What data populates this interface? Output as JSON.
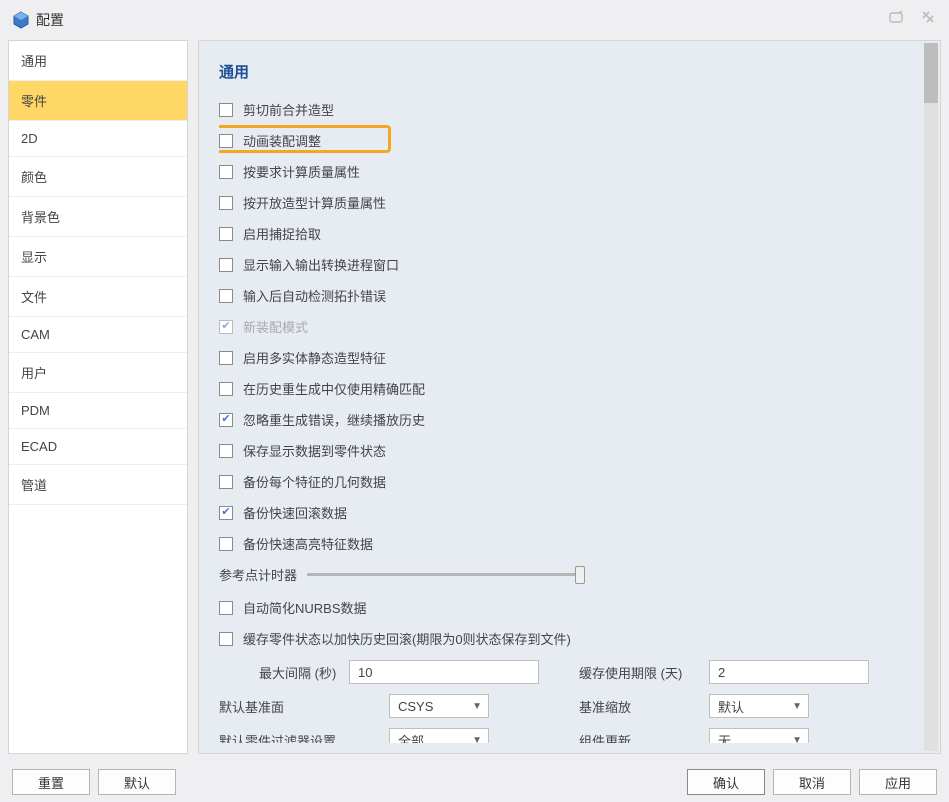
{
  "window": {
    "title": "配置"
  },
  "sidebar": {
    "items": [
      "通用",
      "零件",
      "2D",
      "颜色",
      "背景色",
      "显示",
      "文件",
      "CAM",
      "用户",
      "PDM",
      "ECAD",
      "管道"
    ],
    "selected_index": 1
  },
  "section": {
    "title": "通用"
  },
  "checks": [
    {
      "label": "剪切前合并造型",
      "checked": false
    },
    {
      "label": "动画装配调整",
      "checked": false,
      "highlighted": true
    },
    {
      "label": "按要求计算质量属性",
      "checked": false
    },
    {
      "label": "按开放造型计算质量属性",
      "checked": false
    },
    {
      "label": "启用捕捉拾取",
      "checked": false
    },
    {
      "label": "显示输入输出转换进程窗口",
      "checked": false
    },
    {
      "label": "输入后自动检测拓扑错误",
      "checked": false
    },
    {
      "label": "新装配模式",
      "checked": true,
      "disabled": true
    },
    {
      "label": "启用多实体静态造型特征",
      "checked": false
    },
    {
      "label": "在历史重生成中仅使用精确匹配",
      "checked": false
    },
    {
      "label": "忽略重生成错误，继续播放历史",
      "checked": true
    },
    {
      "label": "保存显示数据到零件状态",
      "checked": false
    },
    {
      "label": "备份每个特征的几何数据",
      "checked": false
    },
    {
      "label": "备份快速回滚数据",
      "checked": true
    },
    {
      "label": "备份快速高亮特征数据",
      "checked": false
    }
  ],
  "slider": {
    "label": "参考点计时器"
  },
  "checks2": [
    {
      "label": "自动简化NURBS数据",
      "checked": false
    },
    {
      "label": "缓存零件状态以加快历史回滚(期限为0则状态保存到文件)",
      "checked": false
    }
  ],
  "row_cache": {
    "l1": "最大间隔 (秒)",
    "v1": "10",
    "l2": "缓存使用期限 (天)",
    "v2": "2"
  },
  "row_datum": {
    "l1": "默认基准面",
    "v1": "CSYS",
    "l2": "基准缩放",
    "v2": "默认"
  },
  "row_filter": {
    "l1": "默认零件过滤器设置",
    "v1": "全部",
    "l2": "组件更新",
    "v2": "无"
  },
  "footer": {
    "reset": "重置",
    "default": "默认",
    "ok": "确认",
    "cancel": "取消",
    "apply": "应用"
  }
}
